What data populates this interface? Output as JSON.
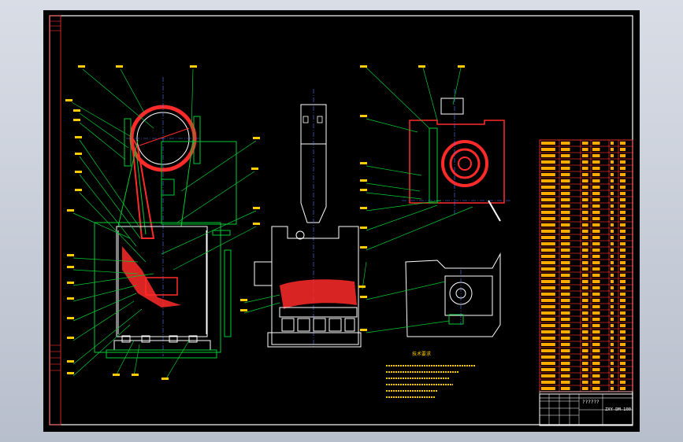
{
  "drawing": {
    "title_block_code": "ZXY-DM-100",
    "title_block_name": "??????"
  },
  "colors": {
    "background": "#000000",
    "frame": "#ffffff",
    "outline_green": "#00cc33",
    "section_red": "#ff2a2a",
    "centerline_blue": "#5577ff",
    "text_yellow": "#ffcc00",
    "bom_fill": "#ffaa00"
  },
  "tech_notes": {
    "heading": "技术要求"
  }
}
